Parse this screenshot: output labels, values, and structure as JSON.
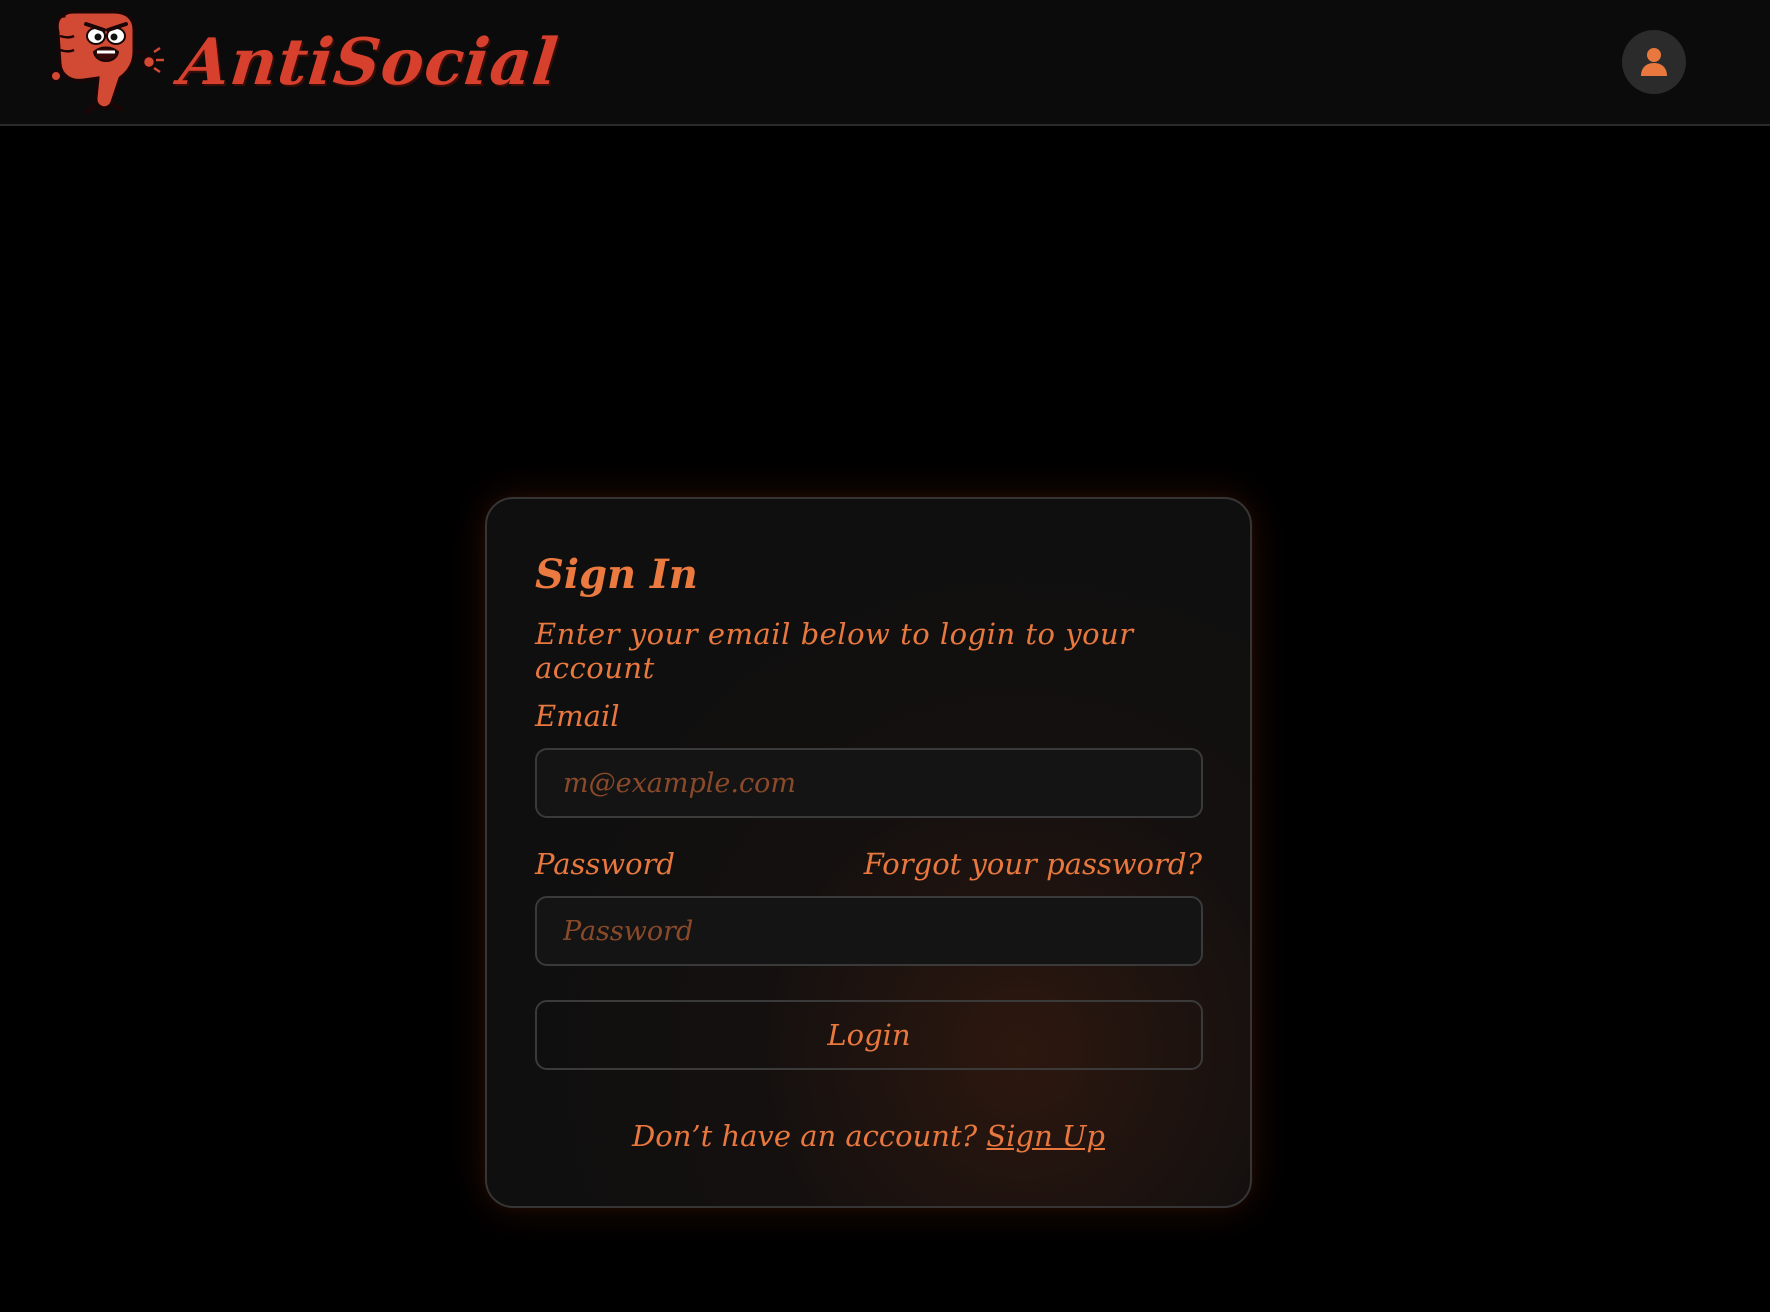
{
  "header": {
    "logo_text": "AntiSocial",
    "avatar_icon": "user-icon",
    "mascot_icon": "angry-thumbs-down-mascot-icon"
  },
  "colors": {
    "accent": "#e8783e",
    "logo_red": "#d8402e",
    "background": "#000000",
    "card_bg": "#0f0f0f",
    "border": "#353535"
  },
  "signin": {
    "title": "Sign In",
    "subtitle": "Enter your email below to login to your account",
    "email_label": "Email",
    "email_placeholder": "m@example.com",
    "email_value": "",
    "password_label": "Password",
    "forgot_link": "Forgot your password?",
    "password_placeholder": "Password",
    "password_value": "",
    "login_label": "Login",
    "no_account_text": "Don’t have an account?",
    "signup_link": "Sign Up"
  }
}
